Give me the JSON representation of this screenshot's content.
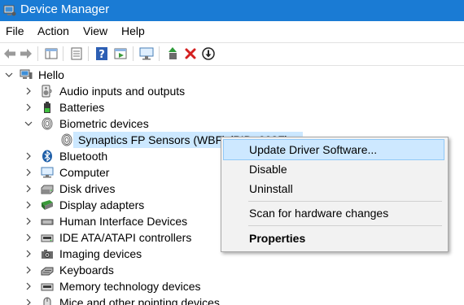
{
  "window": {
    "title": "Device Manager"
  },
  "menu": [
    "File",
    "Action",
    "View",
    "Help"
  ],
  "toolbar": {
    "buttons": [
      "back-icon",
      "forward-icon",
      "properties-view-icon",
      "show-hidden-icon",
      "help-icon",
      "action-view-icon",
      "monitor-icon",
      "update-driver-icon",
      "uninstall-icon",
      "disable-icon"
    ]
  },
  "tree": {
    "root": "Hello",
    "categories": [
      {
        "label": "Audio inputs and outputs",
        "icon": "speaker-icon",
        "expanded": false
      },
      {
        "label": "Batteries",
        "icon": "battery-icon",
        "expanded": false
      },
      {
        "label": "Biometric devices",
        "icon": "fingerprint-icon",
        "expanded": true
      },
      {
        "label": "Synaptics FP Sensors (WBF) (PID=003F)",
        "icon": "fingerprint-icon",
        "child": true,
        "selected": true
      },
      {
        "label": "Bluetooth",
        "icon": "bluetooth-icon",
        "expanded": false
      },
      {
        "label": "Computer",
        "icon": "computer-icon",
        "expanded": false
      },
      {
        "label": "Disk drives",
        "icon": "disk-icon",
        "expanded": false
      },
      {
        "label": "Display adapters",
        "icon": "display-icon",
        "expanded": false
      },
      {
        "label": "Human Interface Devices",
        "icon": "hid-icon",
        "expanded": false
      },
      {
        "label": "IDE ATA/ATAPI controllers",
        "icon": "ide-icon",
        "expanded": false
      },
      {
        "label": "Imaging devices",
        "icon": "camera-icon",
        "expanded": false
      },
      {
        "label": "Keyboards",
        "icon": "keyboard-icon",
        "expanded": false
      },
      {
        "label": "Memory technology devices",
        "icon": "memory-icon",
        "expanded": false
      },
      {
        "label": "Mice and other pointing devices",
        "icon": "mouse-icon",
        "expanded": false
      }
    ]
  },
  "context_menu": {
    "items": [
      {
        "label": "Update Driver Software...",
        "highlighted": true
      },
      {
        "label": "Disable"
      },
      {
        "label": "Uninstall"
      },
      {
        "separator": true
      },
      {
        "label": "Scan for hardware changes"
      },
      {
        "separator": true
      },
      {
        "label": "Properties",
        "bold": true
      }
    ]
  },
  "colors": {
    "titlebar": "#1a7bd4",
    "selection": "#cce8ff",
    "menu_highlight": "#91c9f7"
  }
}
